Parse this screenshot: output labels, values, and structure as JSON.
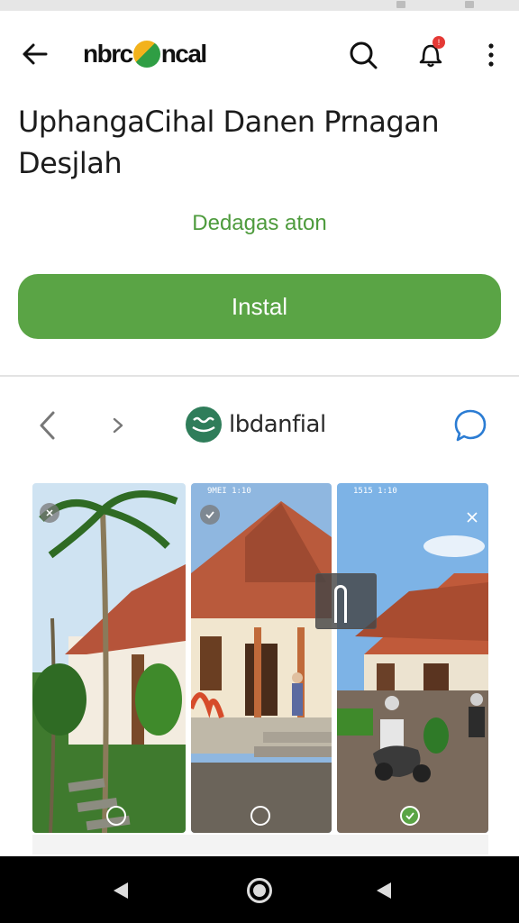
{
  "app_bar": {
    "brand_left": "nbrc",
    "brand_right": "ncal",
    "search_icon": "search-icon",
    "notification_icon": "bell-icon",
    "notification_badge": "!",
    "more_icon": "more-vertical-icon",
    "back_icon": "arrow-left-icon"
  },
  "listing": {
    "title": "UphangaCihal Danen Prnagan Desjlah",
    "subtitle": "Dedagas aton",
    "install_label": "Instal",
    "accent_color": "#5aa445"
  },
  "gallery": {
    "brand_name": "lbdanfial",
    "prev_icon": "chevron-left-icon",
    "next_icon": "chevron-right-icon",
    "chat_icon": "chat-bubble-icon",
    "screenshots": [
      {
        "status": "",
        "selected": false
      },
      {
        "status": "9MEI 1:10",
        "selected": false
      },
      {
        "status": "1515 1:10",
        "selected": true
      }
    ]
  },
  "system_nav": {
    "back_icon": "nav-back-icon",
    "home_icon": "nav-home-icon",
    "recent_icon": "nav-recent-icon"
  }
}
